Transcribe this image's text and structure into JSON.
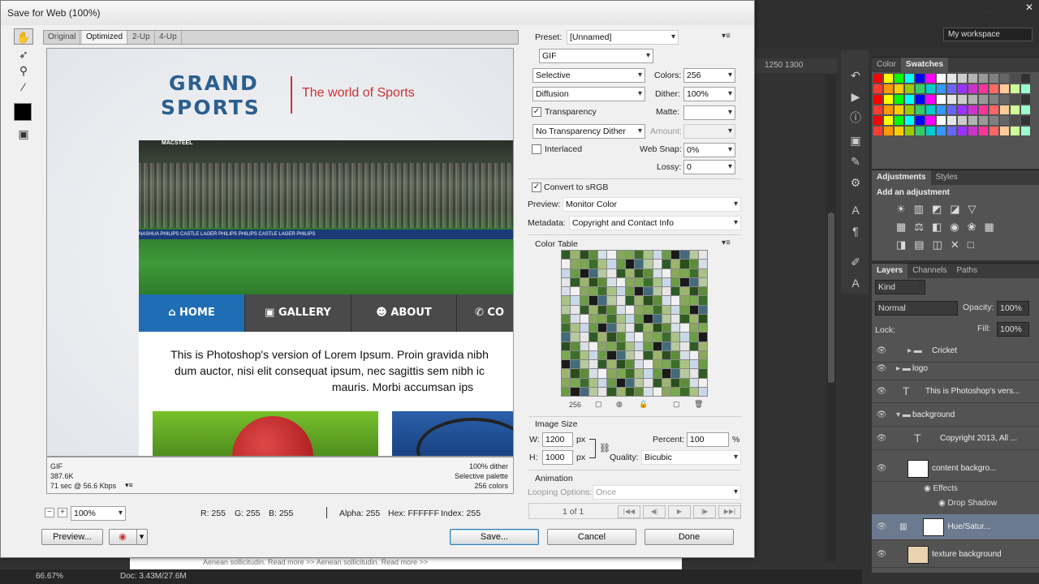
{
  "dialog": {
    "title": "Save for Web (100%)"
  },
  "view_tabs": [
    "Original",
    "Optimized",
    "2-Up",
    "4-Up"
  ],
  "preview": {
    "logo_line1": "GRAND",
    "logo_line2": "SPORTS",
    "tagline": "The world of Sports",
    "stadium_sign": "MACSTEEL",
    "banner_text": "NASHUA   PHILIPS   CASTLE LAGER   PHILIPS   PHILIPS   CASTLE LAGER   PHILIPS",
    "nav": [
      "HOME",
      "GALLERY",
      "ABOUT",
      "CO"
    ],
    "lorem_1": "This is Photoshop's version  of Lorem Ipsum. Proin gravida nibh",
    "lorem_2": "dum auctor, nisi elit consequat ipsum, nec sagittis sem nibh ic",
    "lorem_3": "mauris. Morbi accumsan ips"
  },
  "preview_info": {
    "format": "GIF",
    "size": "387.6K",
    "time": "71 sec @ 56.6 Kbps",
    "dither": "100% dither",
    "palette": "Selective palette",
    "colors": "256 colors"
  },
  "zoom": {
    "value": "100%",
    "r": "R: 255",
    "g": "G: 255",
    "b": "B: 255",
    "alpha": "Alpha: 255",
    "hex": "Hex: FFFFFF",
    "index": "Index: 255"
  },
  "buttons": {
    "preview": "Preview...",
    "save": "Save...",
    "cancel": "Cancel",
    "done": "Done"
  },
  "settings": {
    "preset_label": "Preset:",
    "preset": "[Unnamed]",
    "format": "GIF",
    "reduction": "Selective",
    "colors_label": "Colors:",
    "colors": "256",
    "dither_algo": "Diffusion",
    "dither_label": "Dither:",
    "dither": "100%",
    "transparency": "Transparency",
    "matte_label": "Matte:",
    "matte": "",
    "trans_dither": "No Transparency Dither",
    "amount_label": "Amount:",
    "interlaced": "Interlaced",
    "websnap_label": "Web Snap:",
    "websnap": "0%",
    "lossy_label": "Lossy:",
    "lossy": "0",
    "srgb": "Convert to sRGB",
    "preview_label": "Preview:",
    "preview_mode": "Monitor Color",
    "metadata_label": "Metadata:",
    "metadata": "Copyright and Contact Info",
    "color_table_label": "Color Table",
    "color_count": "256",
    "image_size_label": "Image Size",
    "w_label": "W:",
    "w": "1200",
    "h_label": "H:",
    "h": "1000",
    "px": "px",
    "percent_label": "Percent:",
    "percent": "100",
    "pct": "%",
    "quality_label": "Quality:",
    "quality": "Bicubic",
    "animation_label": "Animation",
    "looping_label": "Looping Options:",
    "looping": "Once",
    "frame": "1 of 1"
  },
  "color_table": [
    "#2e5c24",
    "#7ba850",
    "#b7c9a0",
    "#f1f1f1",
    "#1a1a1a",
    "#5e8d3a",
    "#c9d8e8",
    "#9db46e",
    "#3c6e2a",
    "#e6e6e6",
    "#88a85c",
    "#436b7c",
    "#d6dfe8",
    "#6b9b44",
    "#2b4f1c",
    "#aac284"
  ],
  "ruler": "1250   1300",
  "canvas_peek": "Aenean sollicitudin. Read more >>                     Aenean sollicitudin. Read more >>",
  "status": {
    "zoom": "66.67%",
    "doc": "Doc: 3.43M/27.6M"
  },
  "workspace": "My workspace",
  "panels": {
    "swatch_tabs": [
      "Color",
      "Swatches"
    ],
    "adj_tabs": [
      "Adjustments",
      "Styles"
    ],
    "adj_head": "Add an adjustment",
    "layer_tabs": [
      "Layers",
      "Channels",
      "Paths"
    ],
    "kind": "Kind",
    "blend": "Normal",
    "opacity_label": "Opacity:",
    "opacity": "100%",
    "lock_label": "Lock:",
    "fill_label": "Fill:",
    "fill": "100%"
  },
  "swatch_colors": [
    "#ff0000",
    "#ffff00",
    "#00ff00",
    "#00ffff",
    "#0000ff",
    "#ff00ff",
    "#ffffff",
    "#e6e6e6",
    "#cccccc",
    "#b3b3b3",
    "#999999",
    "#808080",
    "#666666",
    "#4d4d4d",
    "#333333",
    "#ff3b2f",
    "#ff9900",
    "#ffcc00",
    "#99cc00",
    "#33cc66",
    "#00cccc",
    "#3399ff",
    "#6666ff",
    "#9933ff",
    "#cc33cc",
    "#ff3399",
    "#ff6666",
    "#ffcc99",
    "#ccff99",
    "#99ffcc"
  ],
  "layers": [
    "Cricket",
    "logo",
    "This is Photoshop's vers...",
    "background",
    "Copyright 2013, All ...",
    "content backgro...",
    "Effects",
    "Drop Shadow",
    "Hue/Satur...",
    "texture background"
  ]
}
